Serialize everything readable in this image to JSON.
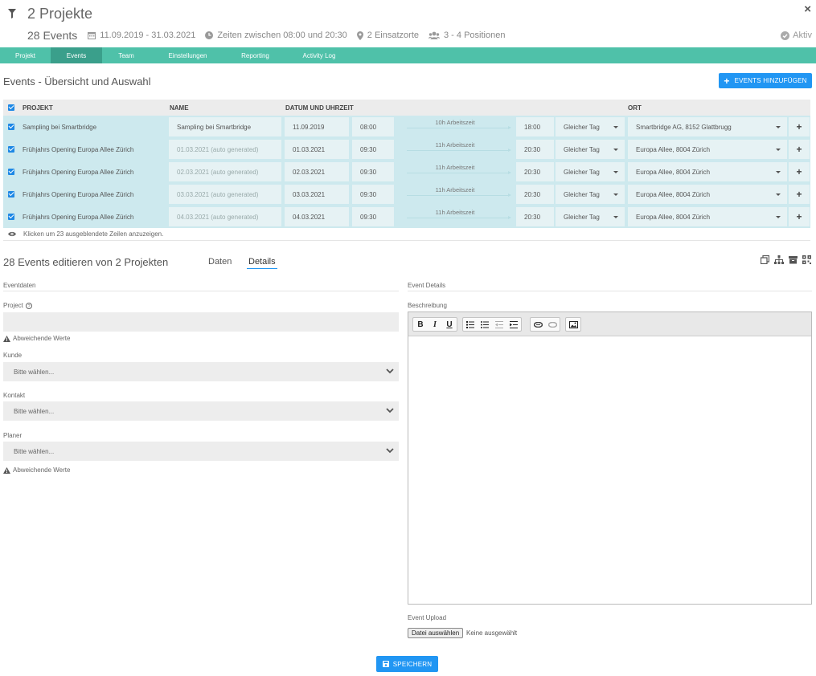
{
  "header": {
    "title": "2 Projekte",
    "event_count": "28 Events",
    "date_range": "11.09.2019 - 31.03.2021",
    "time_range": "Zeiten zwischen 08:00 und 20:30",
    "locations": "2 Einsatzorte",
    "positions": "3 - 4 Positionen",
    "status": "Aktiv",
    "close": "×"
  },
  "tabs": [
    {
      "label": "Projekt"
    },
    {
      "label": "Events"
    },
    {
      "label": "Team"
    },
    {
      "label": "Einstellungen"
    },
    {
      "label": "Reporting"
    },
    {
      "label": "Activity Log"
    }
  ],
  "events_section": {
    "title": "Events - Übersicht und Auswahl",
    "add_button": "EVENTS HINZUFÜGEN",
    "columns": {
      "projekt": "PROJEKT",
      "name": "NAME",
      "datum": "DATUM UND UHRZEIT",
      "ort": "ORT"
    },
    "rows": [
      {
        "project": "Sampling bei Smartbridge",
        "name": "Sampling bei Smartbridge",
        "date": "11.09.2019",
        "start": "08:00",
        "duration": "10h Arbeitszeit",
        "end": "18:00",
        "day": "Gleicher Tag",
        "location": "Smartbridge AG, 8152 Glattbrugg"
      },
      {
        "project": "Frühjahrs Opening Europa Allee Zürich",
        "name": "01.03.2021 (auto generated)",
        "date": "01.03.2021",
        "start": "09:30",
        "duration": "11h Arbeitszeit",
        "end": "20:30",
        "day": "Gleicher Tag",
        "location": "Europa Allee, 8004 Zürich"
      },
      {
        "project": "Frühjahrs Opening Europa Allee Zürich",
        "name": "02.03.2021 (auto generated)",
        "date": "02.03.2021",
        "start": "09:30",
        "duration": "11h Arbeitszeit",
        "end": "20:30",
        "day": "Gleicher Tag",
        "location": "Europa Allee, 8004 Zürich"
      },
      {
        "project": "Frühjahrs Opening Europa Allee Zürich",
        "name": "03.03.2021 (auto generated)",
        "date": "03.03.2021",
        "start": "09:30",
        "duration": "11h Arbeitszeit",
        "end": "20:30",
        "day": "Gleicher Tag",
        "location": "Europa Allee, 8004 Zürich"
      },
      {
        "project": "Frühjahrs Opening Europa Allee Zürich",
        "name": "04.03.2021 (auto generated)",
        "date": "04.03.2021",
        "start": "09:30",
        "duration": "11h Arbeitszeit",
        "end": "20:30",
        "day": "Gleicher Tag",
        "location": "Europa Allee, 8004 Zürich"
      }
    ],
    "hidden_rows": "Klicken um 23 ausgeblendete Zeilen anzuzeigen."
  },
  "edit_section": {
    "title": "28 Events editieren von 2 Projekten",
    "subtabs": [
      "Daten",
      "Details"
    ],
    "left_header": "Eventdaten",
    "right_header": "Event Details",
    "project_label": "Project",
    "warning": "Abweichende Werte",
    "kunde_label": "Kunde",
    "kontakt_label": "Kontakt",
    "planer_label": "Planer",
    "select_placeholder": "Bitte wählen...",
    "description_label": "Beschreibung",
    "upload_label": "Event Upload",
    "file_button": "Datei auswählen",
    "file_none": "Keine ausgewählt",
    "save_button": "SPEICHERN"
  },
  "colors": {
    "tab_bar": "#4fc1a9",
    "tab_active": "#3a9f8b",
    "primary": "#2196f3",
    "row_bg": "#cde9ee"
  }
}
